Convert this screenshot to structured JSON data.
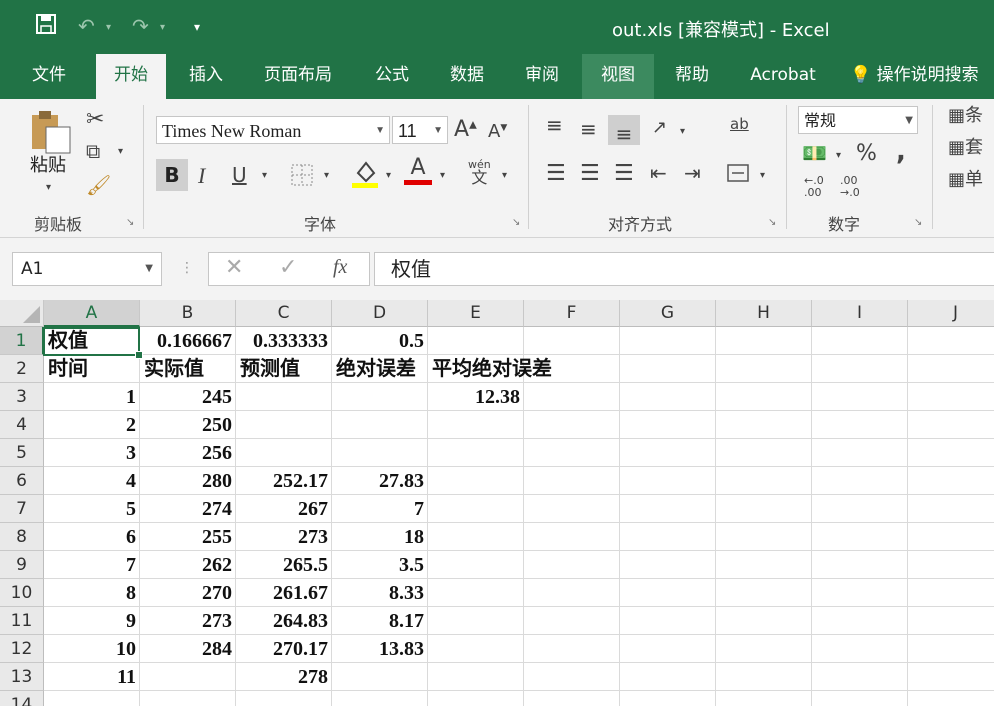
{
  "window": {
    "title": "out.xls  [兼容模式]  -  Excel"
  },
  "quick_access": {
    "save_icon": "save-icon",
    "undo_icon": "undo-icon",
    "redo_icon": "redo-icon",
    "customize_icon": "customize-qat-icon"
  },
  "tabs": [
    "文件",
    "开始",
    "插入",
    "页面布局",
    "公式",
    "数据",
    "审阅",
    "视图",
    "帮助",
    "Acrobat",
    "操作说明搜索"
  ],
  "active_tab": "开始",
  "ribbon": {
    "clipboard": {
      "paste_label": "粘贴",
      "group_label": "剪贴板"
    },
    "font": {
      "font_name": "Times New Roman",
      "font_size": "11",
      "bold": "B",
      "italic": "I",
      "underline": "U",
      "phonetic": "wén",
      "phonetic_char": "文",
      "font_color_letter": "A",
      "group_label": "字体",
      "font_color": "#e00000",
      "fill_color": "#ffff00"
    },
    "alignment": {
      "group_label": "对齐方式",
      "wrap": "ab"
    },
    "number": {
      "format": "常规",
      "percent": "%",
      "comma": ",",
      "group_label": "数字"
    },
    "styles": {
      "cond": "条",
      "table": "套",
      "cell": "单"
    }
  },
  "formula_bar": {
    "name_box": "A1",
    "formula": "权值",
    "fx": "fx"
  },
  "columns": [
    "A",
    "B",
    "C",
    "D",
    "E",
    "F",
    "G",
    "H",
    "I",
    "J"
  ],
  "rows": [
    "1",
    "2",
    "3",
    "4",
    "5",
    "6",
    "7",
    "8",
    "9",
    "10",
    "11",
    "12",
    "13",
    "14"
  ],
  "cells": {
    "A1": "权值",
    "B1": "0.166667",
    "C1": "0.333333",
    "D1": "0.5",
    "A2": "时间",
    "B2": "实际值",
    "C2": "预测值",
    "D2": "绝对误差",
    "E2": "平均绝对误差",
    "A3": "1",
    "B3": "245",
    "E3": "12.38",
    "A4": "2",
    "B4": "250",
    "A5": "3",
    "B5": "256",
    "A6": "4",
    "B6": "280",
    "C6": "252.17",
    "D6": "27.83",
    "A7": "5",
    "B7": "274",
    "C7": "267",
    "D7": "7",
    "A8": "6",
    "B8": "255",
    "C8": "273",
    "D8": "18",
    "A9": "7",
    "B9": "262",
    "C9": "265.5",
    "D9": "3.5",
    "A10": "8",
    "B10": "270",
    "C10": "261.67",
    "D10": "8.33",
    "A11": "9",
    "B11": "273",
    "C11": "264.83",
    "D11": "8.17",
    "A12": "10",
    "B12": "284",
    "C12": "270.17",
    "D12": "13.83",
    "A13": "11",
    "C13": "278"
  },
  "theme": {
    "accent": "#217346"
  }
}
